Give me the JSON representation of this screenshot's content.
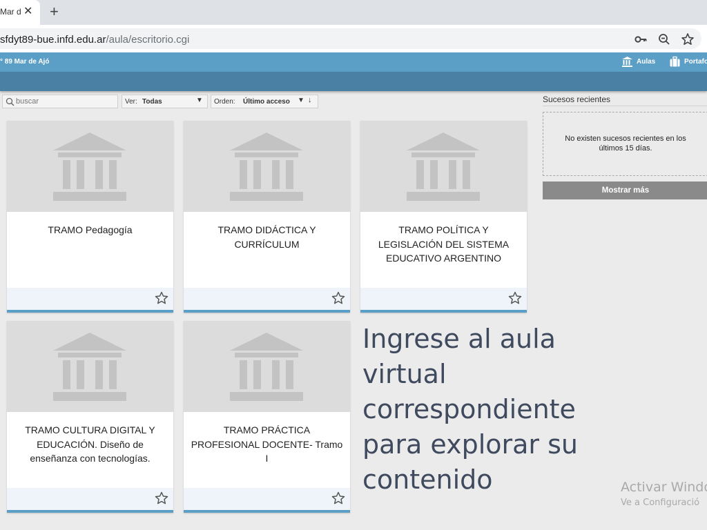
{
  "browser": {
    "tab_title": "Mar d",
    "url_host": "sfdyt89-bue.infd.edu.ar",
    "url_path": "/aula/escritorio.cgi",
    "icons": [
      "key-icon",
      "zoom-out-icon",
      "bookmark-star-icon"
    ]
  },
  "site": {
    "name": "° 89 Mar de Ajó",
    "nav": [
      {
        "label": "Aulas",
        "icon": "building-icon"
      },
      {
        "label": "Portafo",
        "icon": "portfolio-icon"
      }
    ],
    "colors": {
      "header": "#5b9ec6",
      "subheader": "#4a80a3",
      "card_bar": "#5b9ec6"
    }
  },
  "filters": {
    "search_placeholder": "buscar",
    "ver_label": "Ver:",
    "ver_value": "Todas",
    "orden_label": "Orden:",
    "orden_value": "Último acceso"
  },
  "courses": [
    {
      "title": "TRAMO Pedagogía"
    },
    {
      "title": "TRAMO DIDÁCTICA Y CURRÍCULUM"
    },
    {
      "title": "TRAMO POLÍTICA Y LEGISLACIÓN DEL SISTEMA EDUCATIVO ARGENTINO"
    },
    {
      "title": "TRAMO CULTURA DIGITAL Y EDUCACIÓN. Diseño de enseñanza con tecnologías."
    },
    {
      "title": "TRAMO PRÁCTICA PROFESIONAL DOCENTE- Tramo I"
    }
  ],
  "recent": {
    "title": "Sucesos recientes",
    "empty_message": "No existen sucesos recientes en los últimos 15 días.",
    "more_button": "Mostrar más"
  },
  "overlay_text": "Ingrese al aula virtual correspondiente para explorar su contenido",
  "watermark": {
    "line1": "Activar Windo",
    "line2": "Ve a Configuració"
  }
}
